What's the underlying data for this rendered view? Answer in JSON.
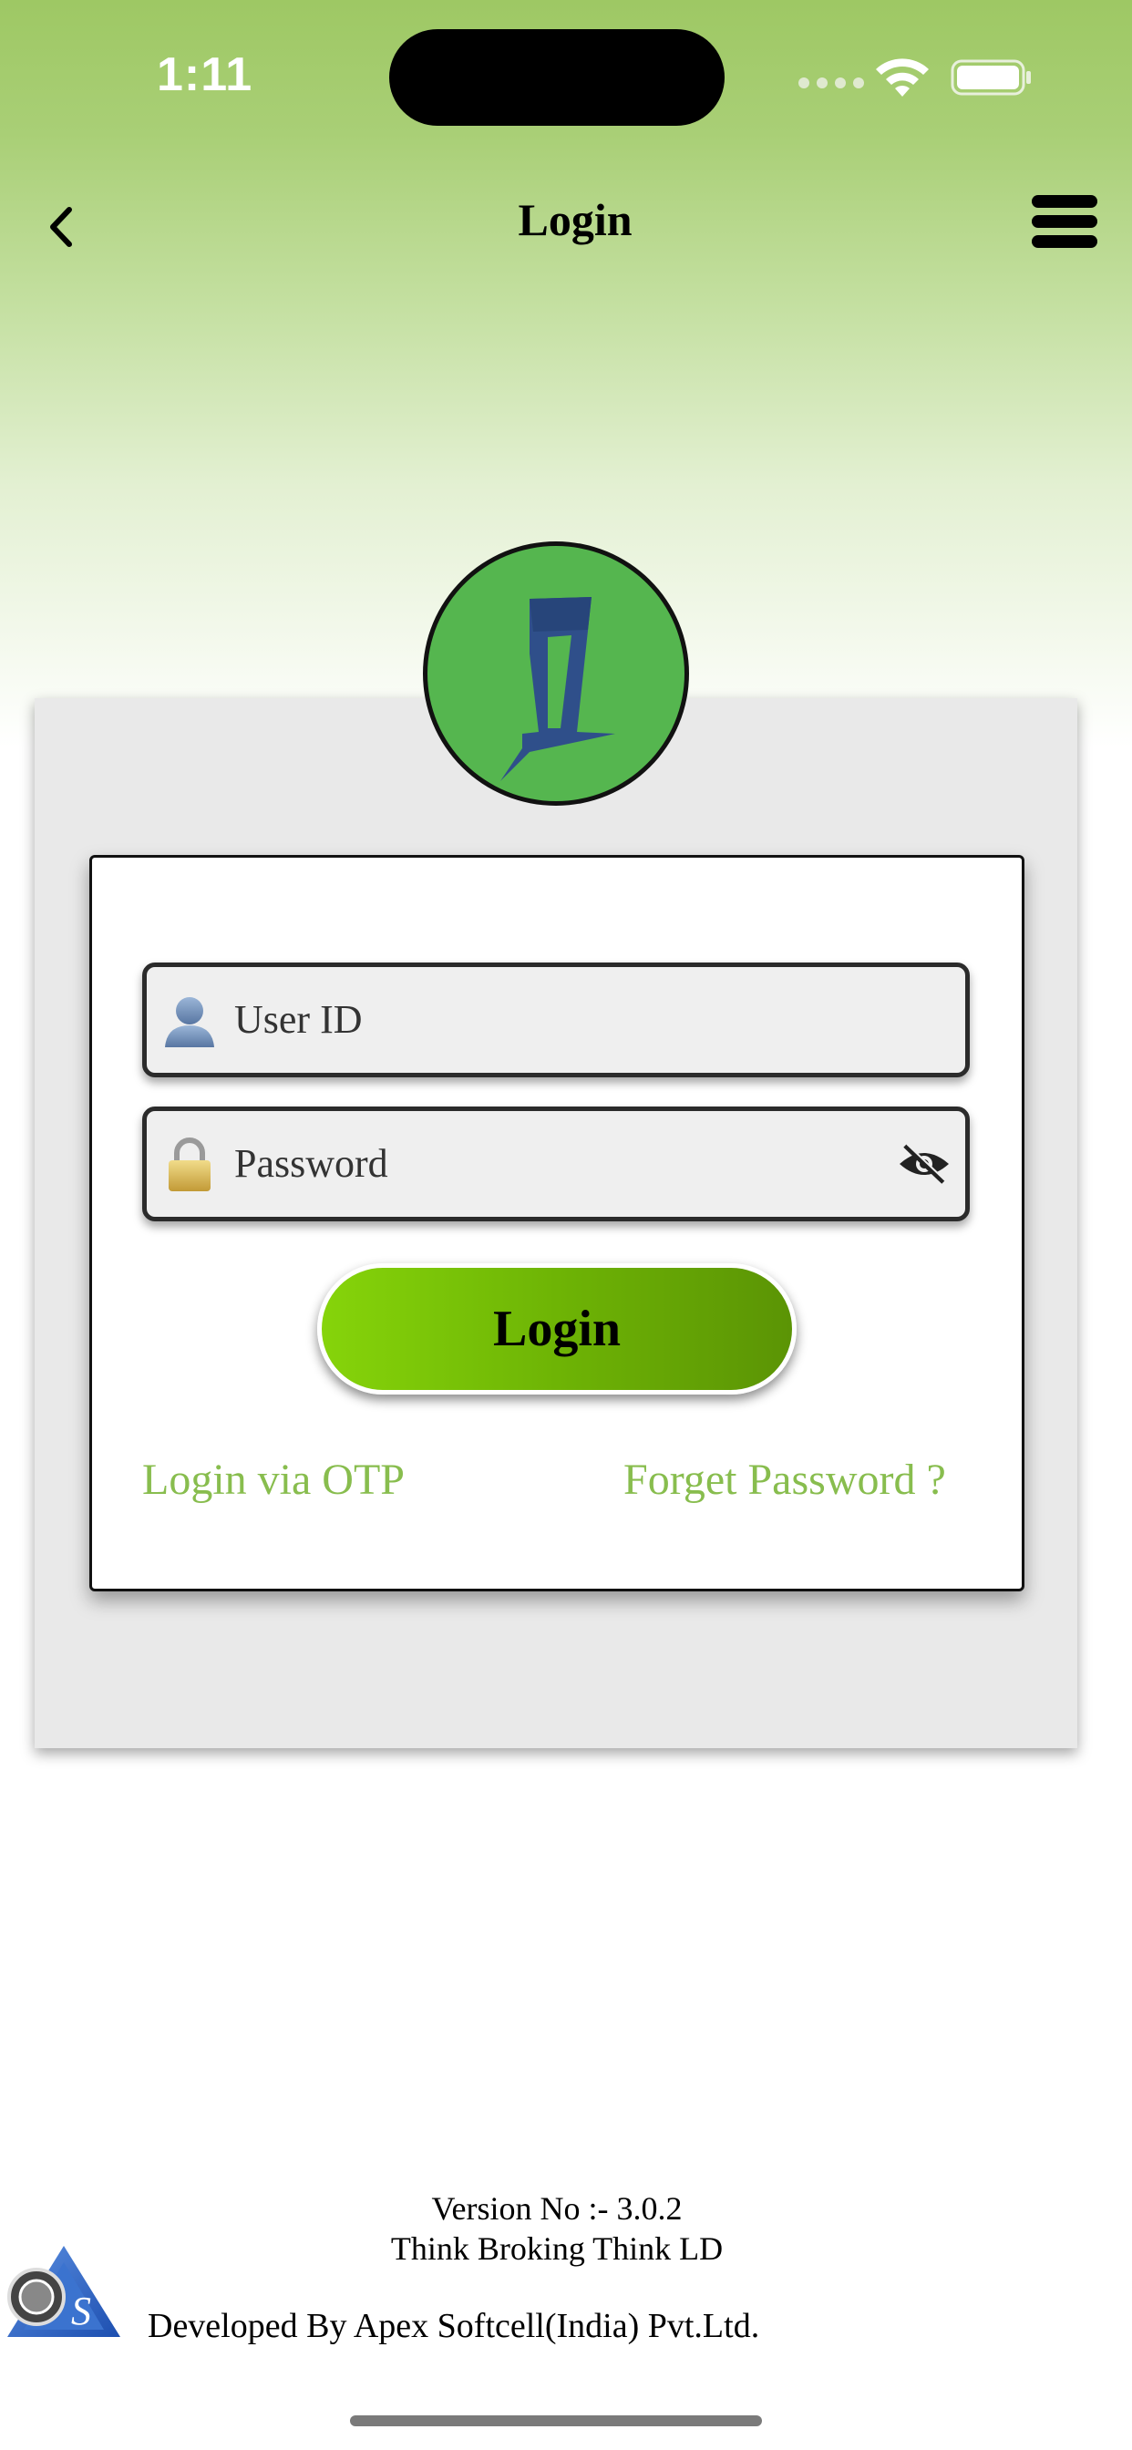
{
  "status_bar": {
    "time": "1:11"
  },
  "nav": {
    "title": "Login"
  },
  "form": {
    "user_placeholder": "User ID",
    "password_placeholder": "Password",
    "login_label": "Login",
    "otp_link": "Login via OTP",
    "forgot_link": "Forget Password ?"
  },
  "footer": {
    "version": "Version No :- 3.0.2",
    "tagline": "Think Broking Think LD",
    "developer": "Developed By Apex Softcell(India) Pvt.Ltd."
  },
  "colors": {
    "header_green": "#9ec864",
    "logo_green": "#55b64f",
    "logo_mark": "#2f4f8a",
    "button_green": "#6eb405",
    "link_green": "#88bd4e"
  },
  "icons": [
    "back-icon",
    "menu-icon",
    "user-icon",
    "lock-icon",
    "eye-icon",
    "wifi-icon",
    "battery-icon"
  ]
}
